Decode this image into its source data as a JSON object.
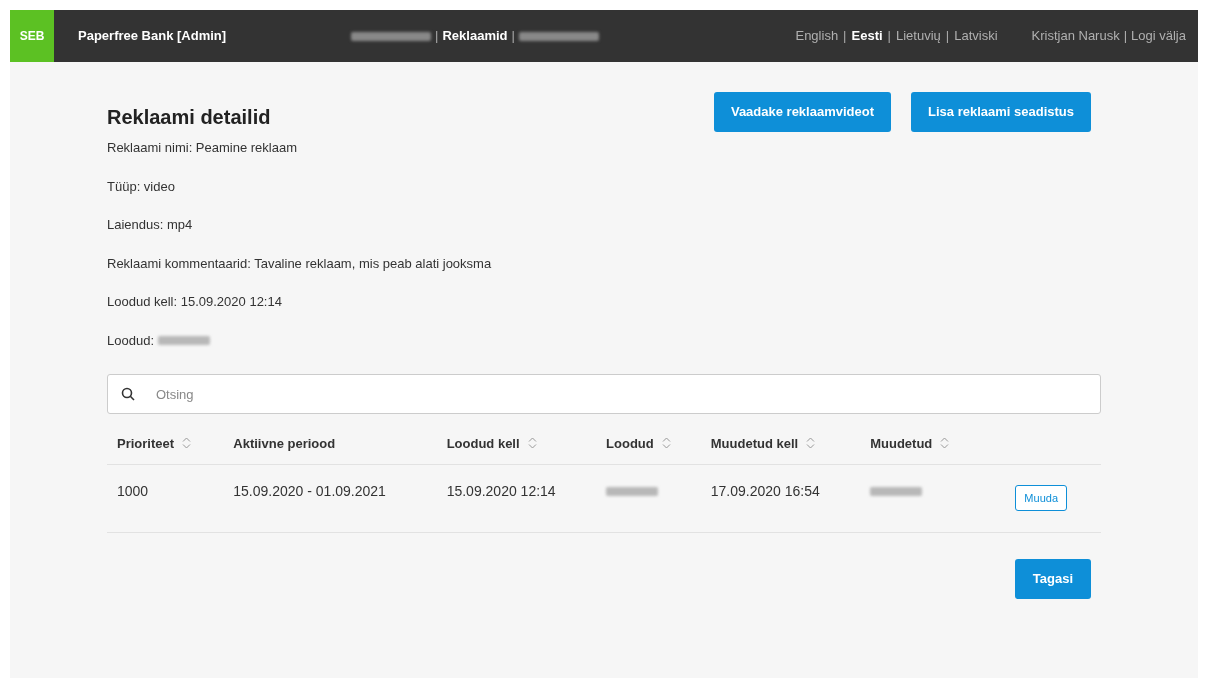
{
  "navbar": {
    "logo": "SEB",
    "app_title": "Paperfree Bank [Admin]",
    "nav_items": [
      {
        "kind": "redacted",
        "selected": false
      },
      {
        "kind": "link",
        "label": "Reklaamid",
        "selected": true
      },
      {
        "kind": "redacted",
        "selected": false
      }
    ],
    "languages": [
      {
        "label": "English",
        "selected": false
      },
      {
        "label": "Eesti",
        "selected": true
      },
      {
        "label": "Lietuvių",
        "selected": false
      },
      {
        "label": "Latviski",
        "selected": false
      }
    ],
    "separator": "|",
    "user": "Kristjan Narusk",
    "logout": "Logi välja"
  },
  "page_title": "Reklaami detailid",
  "header_buttons": [
    "Vaadake reklaamvideot",
    "Lisa reklaami seadistus"
  ],
  "details": [
    "Reklaami nimi: Peamine reklaam",
    "Tüüp: video",
    "Laiendus: mp4",
    "Reklaami kommentaarid: Tavaline reklaam, mis peab alati jooksma",
    "Loodud kell: 15.09.2020 12:14"
  ],
  "created_by_label": "Loodud:",
  "search": {
    "placeholder": "Otsing"
  },
  "table": {
    "columns": [
      {
        "label": "Prioriteet",
        "sortable": true
      },
      {
        "label": "Aktiivne periood",
        "sortable": false
      },
      {
        "label": "Loodud kell",
        "sortable": true
      },
      {
        "label": "Loodud",
        "sortable": true
      },
      {
        "label": "Muudetud kell",
        "sortable": true
      },
      {
        "label": "Muudetud",
        "sortable": true
      }
    ],
    "rows": [
      {
        "cells": [
          {
            "kind": "text",
            "text": "1000"
          },
          {
            "kind": "text",
            "text": "15.09.2020 - 01.09.2021"
          },
          {
            "kind": "text",
            "text": "15.09.2020 12:14"
          },
          {
            "kind": "redacted"
          },
          {
            "kind": "text",
            "text": "17.09.2020 16:54"
          },
          {
            "kind": "redacted"
          }
        ],
        "action": "Muuda"
      }
    ]
  },
  "back_button": "Tagasi"
}
